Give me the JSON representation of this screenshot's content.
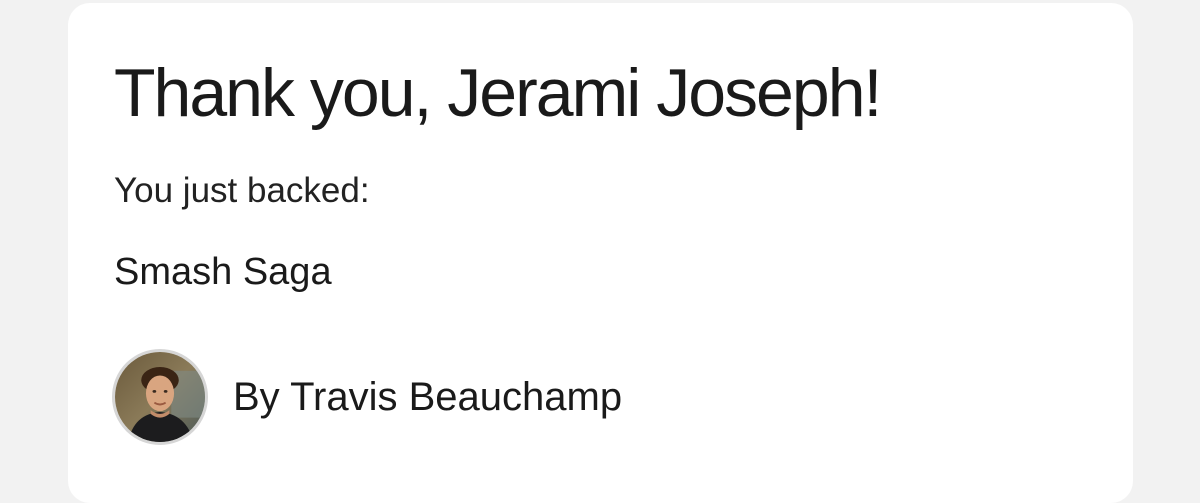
{
  "confirmation": {
    "title": "Thank you, Jerami Joseph!",
    "subtitle": "You just backed:",
    "project_name": "Smash Saga",
    "creator_label": "By Travis Beauchamp",
    "avatar_icon": "creator-avatar-photo"
  },
  "colors": {
    "page_background": "#f2f2f2",
    "card_background": "#ffffff",
    "text": "#1a1a1a"
  }
}
